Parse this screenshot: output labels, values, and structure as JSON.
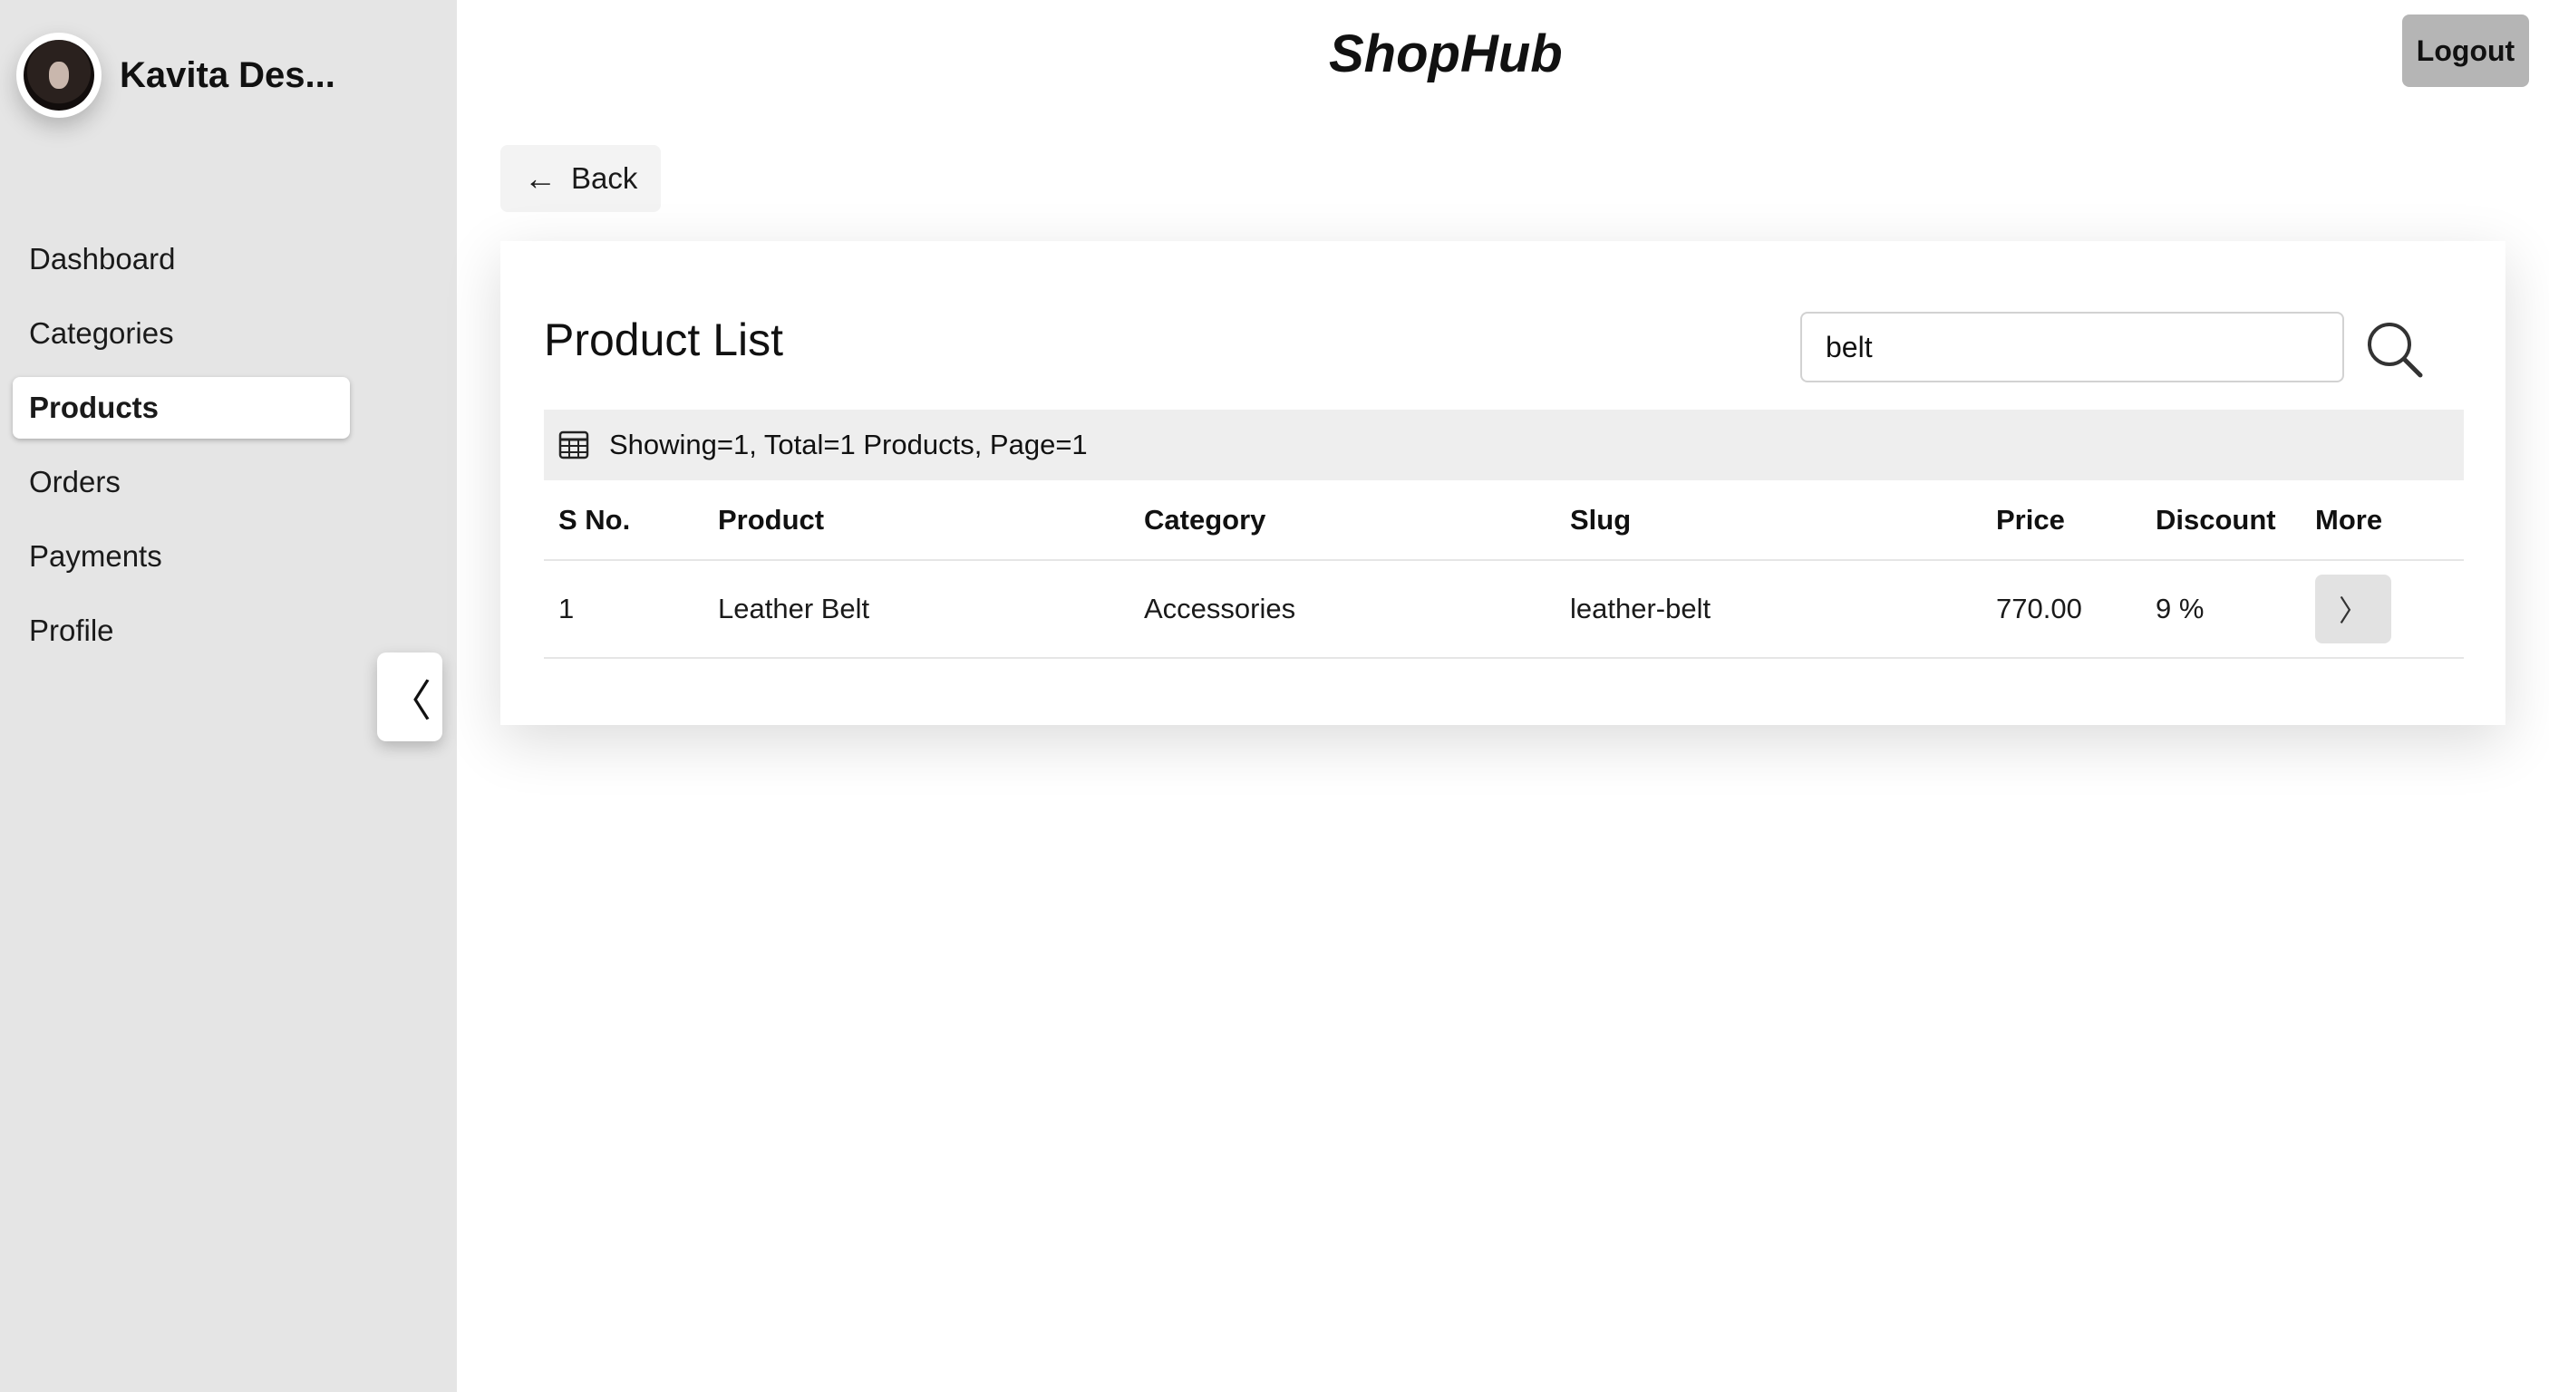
{
  "sidebar": {
    "user_name": "Kavita Des...",
    "items": [
      {
        "label": "Dashboard",
        "active": false
      },
      {
        "label": "Categories",
        "active": false
      },
      {
        "label": "Products",
        "active": true
      },
      {
        "label": "Orders",
        "active": false
      },
      {
        "label": "Payments",
        "active": false
      },
      {
        "label": "Profile",
        "active": false
      }
    ],
    "collapse_glyph": "〈"
  },
  "header": {
    "brand": "ShopHub",
    "logout_label": "Logout"
  },
  "back": {
    "label": "Back",
    "arrow": "←"
  },
  "main": {
    "title": "Product List",
    "search": {
      "value": "belt",
      "placeholder": ""
    },
    "summary": "Showing=1, Total=1 Products, Page=1",
    "table": {
      "columns": [
        "S No.",
        "Product",
        "Category",
        "Slug",
        "Price",
        "Discount",
        "More"
      ],
      "rows": [
        {
          "sno": "1",
          "product": "Leather Belt",
          "category": "Accessories",
          "slug": "leather-belt",
          "price": "770.00",
          "discount": "9 %",
          "more": "〉"
        }
      ]
    }
  },
  "icons": {
    "search": "search-icon",
    "table": "table-icon",
    "back": "arrow-left-icon",
    "more": "chevron-right-icon",
    "collapse": "chevron-left-icon"
  }
}
